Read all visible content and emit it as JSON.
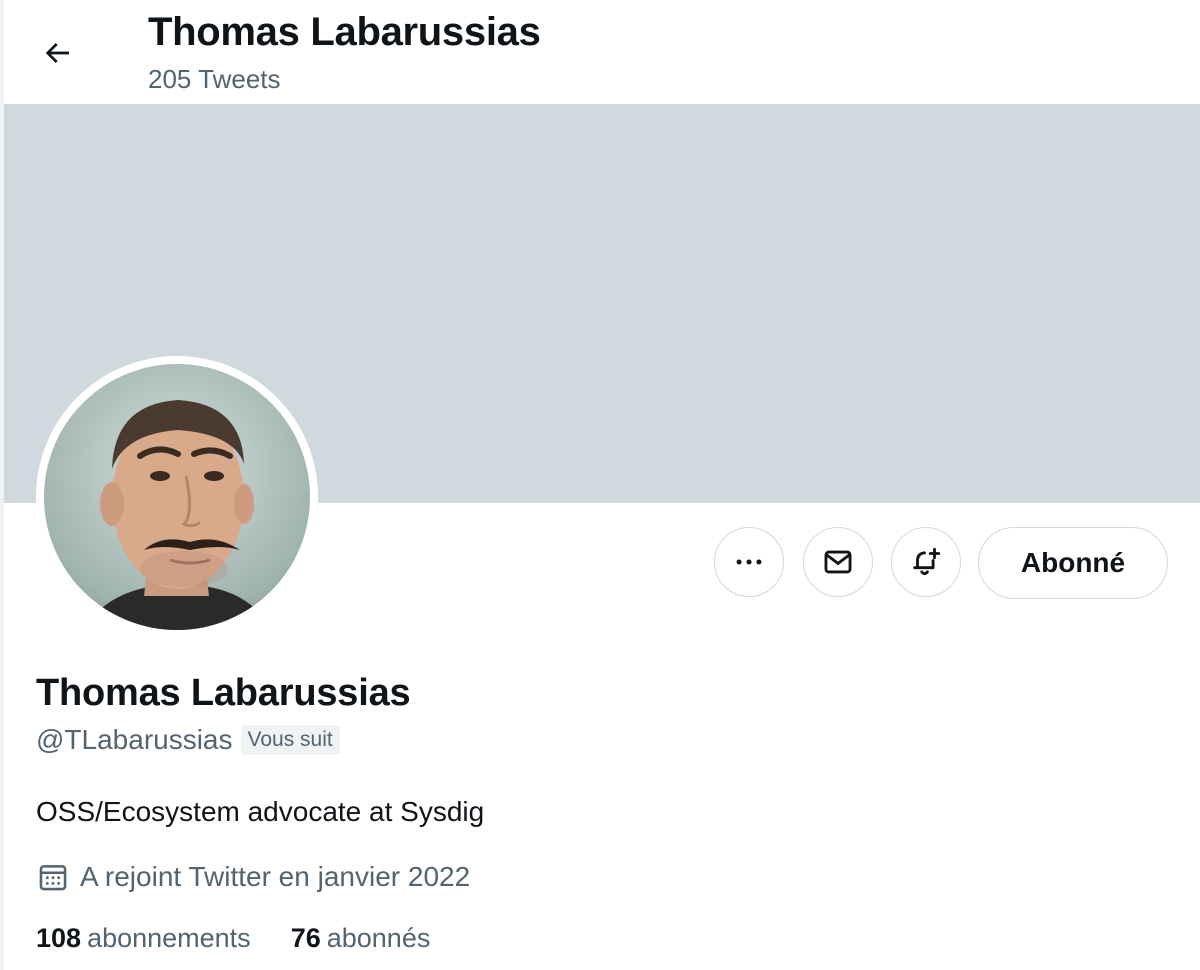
{
  "header": {
    "title": "Thomas Labarussias",
    "tweet_count": "205 Tweets",
    "back_icon": "arrow-left-icon"
  },
  "banner": {
    "color": "#cfd9de"
  },
  "actions": {
    "more_icon": "ellipsis-icon",
    "message_icon": "envelope-icon",
    "notify_icon": "bell-plus-icon",
    "follow_label": "Abonné"
  },
  "profile": {
    "name": "Thomas Labarussias",
    "handle": "@TLabarussias",
    "follows_you": "Vous suit",
    "bio": "OSS/Ecosystem advocate at Sysdig",
    "joined": "A rejoint Twitter en janvier 2022",
    "joined_icon": "calendar-icon"
  },
  "stats": {
    "following_count": "108",
    "following_label": "abonnements",
    "followers_count": "76",
    "followers_label": "abonnés"
  },
  "colors": {
    "text_primary": "#0f1419",
    "text_secondary": "#536471",
    "border": "#cfd9de"
  }
}
